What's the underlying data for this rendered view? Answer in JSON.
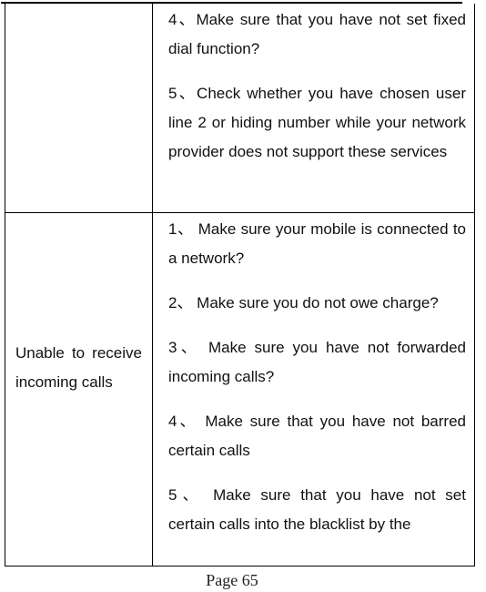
{
  "table": {
    "rows": [
      {
        "problem": "",
        "solutions": [
          "4、Make sure that you have not set fixed dial function?",
          "5、Check whether you have chosen user line 2 or hiding number while your network provider does not support these services"
        ]
      },
      {
        "problem": "Unable to receive incoming calls",
        "solutions": [
          "1、 Make sure your mobile is connected to a network?",
          "2、 Make sure you do not owe charge?",
          "3、 Make sure you have not forwarded incoming calls?",
          "4、 Make sure that you have not barred certain calls",
          "5、 Make sure that you have not set certain calls into the blacklist by the"
        ]
      }
    ]
  },
  "footer": {
    "page_label": "Page 65"
  }
}
